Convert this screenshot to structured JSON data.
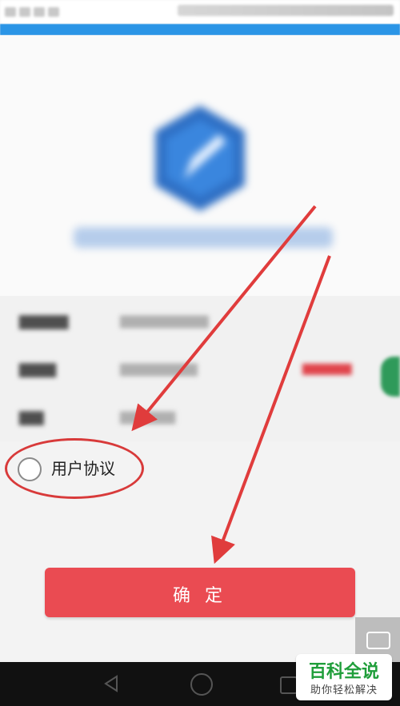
{
  "agreement": {
    "label": "用户协议"
  },
  "confirm": {
    "label": "确 定"
  },
  "watermark": {
    "title": "百科全说",
    "subtitle": "助你轻松解决"
  },
  "colors": {
    "accent_blue": "#2b95e6",
    "confirm_red": "#ea4b52",
    "annotation_red": "#d83a3a",
    "watermark_green": "#1f9e3a"
  },
  "icons": [
    "app-logo-icon",
    "back-nav-icon",
    "home-nav-icon",
    "recent-apps-nav-icon",
    "floating-action-icon",
    "side-share-icon"
  ]
}
